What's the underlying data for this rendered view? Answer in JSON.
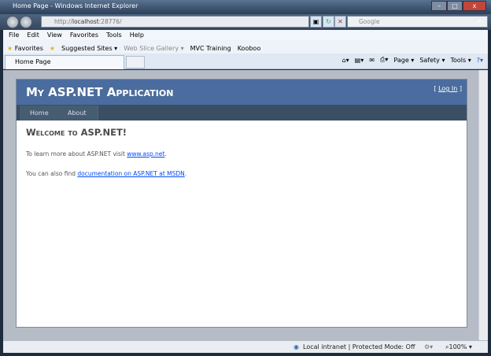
{
  "window": {
    "title": "Home Page - Windows Internet Explorer",
    "min": "–",
    "max": "□",
    "close": "x"
  },
  "address": {
    "prefix": "http://",
    "host": "localhost",
    "port": ":28776/"
  },
  "search": {
    "placeholder": "Google"
  },
  "menu": [
    "File",
    "Edit",
    "View",
    "Favorites",
    "Tools",
    "Help"
  ],
  "favorites": {
    "label": "Favorites",
    "items": [
      "Suggested Sites ▾",
      "Web Slice Gallery ▾",
      "MVC Training",
      "Kooboo"
    ]
  },
  "tab": {
    "label": "Home Page"
  },
  "commandbar": [
    "Page ▾",
    "Safety ▾",
    "Tools ▾"
  ],
  "site": {
    "title": "My ASP.NET Application",
    "login_open": "[ ",
    "login": "Log In",
    "login_close": " ]",
    "nav": [
      "Home",
      "About"
    ],
    "heading": "Welcome to ASP.NET!",
    "p1_text": "To learn more about ASP.NET visit ",
    "p1_link": "www.asp.net",
    "p1_end": ".",
    "p2_text": "You can also find ",
    "p2_link": "documentation on ASP.NET at MSDN",
    "p2_end": "."
  },
  "status": {
    "zone": "Local intranet | Protected Mode: Off",
    "zoom": "100%"
  }
}
